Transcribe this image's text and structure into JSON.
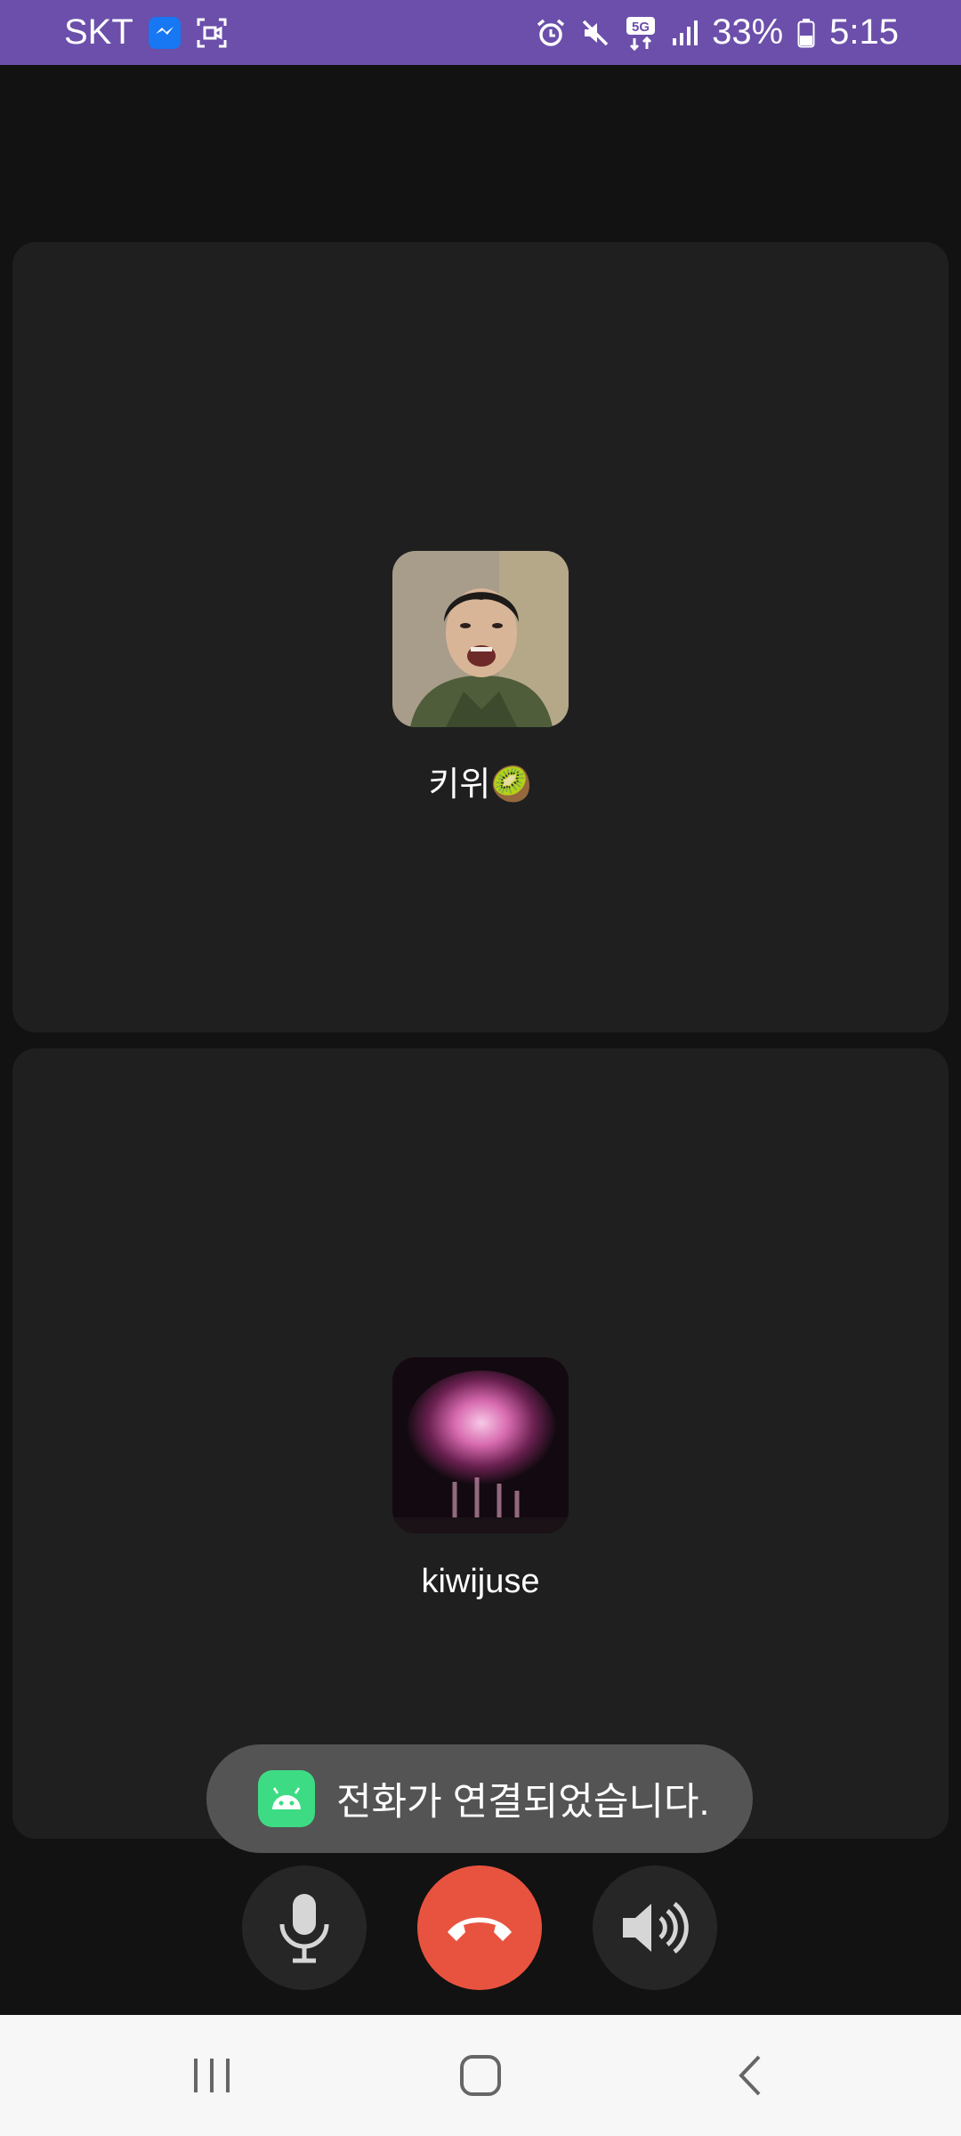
{
  "status_bar": {
    "carrier": "SKT",
    "network": "5G",
    "battery": "33%",
    "time": "5:15",
    "color": "#6b4faa"
  },
  "participants": [
    {
      "name": "키위🥝",
      "avatar": "photo-avatar"
    },
    {
      "name": "kiwijuse",
      "avatar": "fireworks-avatar"
    }
  ],
  "toast": {
    "message": "전화가 연결되었습니다."
  },
  "controls": {
    "mic": "mic-icon",
    "end_call": "end-call-icon",
    "end_call_color": "#e8533f",
    "speaker": "speaker-icon"
  },
  "nav": [
    "recent-apps-icon",
    "home-icon",
    "back-icon"
  ]
}
